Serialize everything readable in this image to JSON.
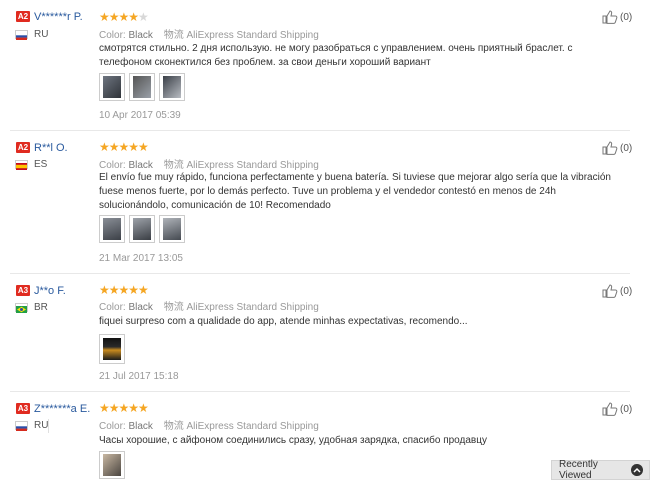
{
  "reviews": [
    {
      "level": "A2",
      "name": "V******r P.",
      "country": "RU",
      "flag": "russia-flag-icon",
      "rating": 4,
      "color_label": "Color:",
      "color_value": "Black",
      "shipping_icon": "物流",
      "shipping": "AliExpress Standard Shipping",
      "text": "смотрятся стильно. 2 дня использую. не могу разобраться с управлением. очень приятный браслет. с телефоном сконектился без проблем. за свои деньги хороший вариант",
      "images": 3,
      "date": "10 Apr 2017 05:39",
      "helpful_count": "(0)"
    },
    {
      "level": "A2",
      "name": "R**l O.",
      "country": "ES",
      "flag": "spain-flag-icon",
      "rating": 5,
      "color_label": "Color:",
      "color_value": "Black",
      "shipping_icon": "物流",
      "shipping": "AliExpress Standard Shipping",
      "text": "El envío fue muy rápido, funciona perfectamente y buena batería. Si tuviese que mejorar algo sería que la vibración fuese menos fuerte, por lo demás perfecto. Tuve un problema y el vendedor contestó en menos de 24h solucionándolo, comunicación de 10! Recomendado",
      "images": 3,
      "date": "21 Mar 2017 13:05",
      "helpful_count": "(0)"
    },
    {
      "level": "A3",
      "name": "J**o F.",
      "country": "BR",
      "flag": "brazil-flag-icon",
      "rating": 5,
      "color_label": "Color:",
      "color_value": "Black",
      "shipping_icon": "物流",
      "shipping": "AliExpress Standard Shipping",
      "text": "fiquei surpreso com a qualidade do app, atende minhas expectativas, recomendo...",
      "images": 1,
      "date": "21 Jul 2017 15:18",
      "helpful_count": "(0)"
    },
    {
      "level": "A3",
      "name": "Z*******a E.",
      "country": "RU",
      "flag": "russia-flag-icon",
      "rating": 5,
      "color_label": "Color:",
      "color_value": "Black",
      "shipping_icon": "物流",
      "shipping": "AliExpress Standard Shipping",
      "text": "Часы хорошие, с айфоном соединились сразу, удобная зарядка, спасибо продавцу",
      "images": 1,
      "date": "",
      "helpful_count": "(0)"
    }
  ],
  "recently_viewed": {
    "label": "Recently Viewed",
    "icon": "chevron-up-icon"
  },
  "colors": {
    "badge": "#e02b20",
    "name": "#2a5a9e",
    "star": "#f5a623"
  }
}
